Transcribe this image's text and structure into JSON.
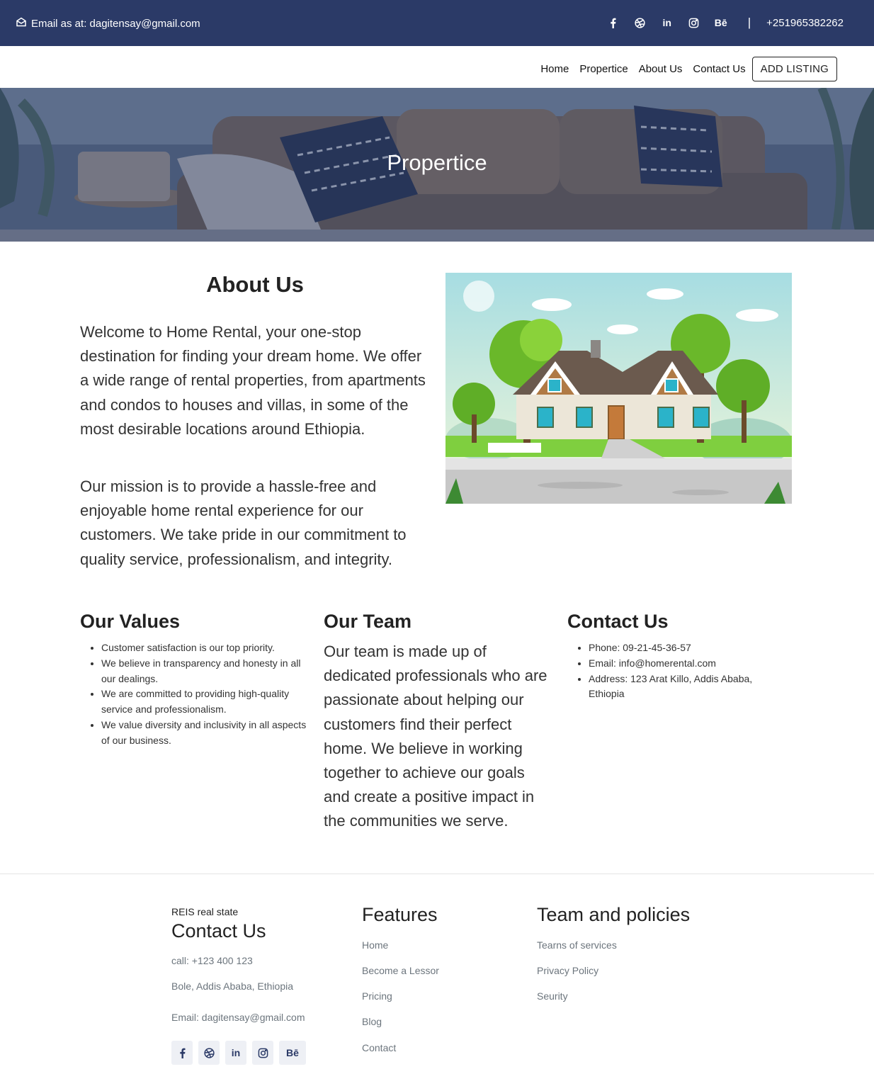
{
  "topbar": {
    "email_text": "Email as at: dagitensay@gmail.com",
    "social": [
      "facebook-icon",
      "dribbble-icon",
      "linkedin-icon",
      "instagram-icon",
      "behance-icon"
    ],
    "linkedin_label": "in",
    "behance_label": "Bē",
    "separator": "|",
    "phone": "+251965382262",
    "bg_color": "#2b3a67"
  },
  "nav": {
    "items": [
      "Home",
      "Propertice",
      "About Us",
      "Contact Us"
    ],
    "cta": "ADD LISTING"
  },
  "hero": {
    "title": "Propertice"
  },
  "about": {
    "heading": "About Us",
    "p1": "Welcome to Home Rental, your one-stop destination for finding your dream home. We offer a wide range of rental properties, from apartments and condos to houses and villas, in some of the most desirable locations around Ethiopia.",
    "p2": "Our mission is to provide a hassle-free and enjoyable home rental experience for our customers. We take pride in our commitment to quality service, professionalism, and integrity."
  },
  "values": {
    "heading": "Our Values",
    "items": [
      "Customer satisfaction is our top priority.",
      "We believe in transparency and honesty in all our dealings.",
      "We are committed to providing high-quality service and professionalism.",
      "We value diversity and inclusivity in all aspects of our business."
    ]
  },
  "team": {
    "heading": "Our Team",
    "text": "Our team is made up of dedicated professionals who are passionate about helping our customers find their perfect home. We believe in working together to achieve our goals and create a positive impact in the communities we serve."
  },
  "contact": {
    "heading": "Contact Us",
    "items": [
      "Phone: 09-21-45-36-57",
      "Email: info@homerental.com",
      "Address: 123 Arat Killo, Addis Ababa, Ethiopia"
    ]
  },
  "footer": {
    "brand": "REIS real state",
    "contact_heading": "Contact Us",
    "call": "call: +123 400 123",
    "address": "Bole, Addis Ababa, Ethiopia",
    "email": "Email: dagitensay@gmail.com",
    "features_heading": "Features",
    "features": [
      "Home",
      "Become a Lessor",
      "Pricing",
      "Blog",
      "Contact"
    ],
    "policies_heading": "Team and policies",
    "policies": [
      "Tearns of services",
      "Privacy Policy",
      "Seurity"
    ]
  }
}
